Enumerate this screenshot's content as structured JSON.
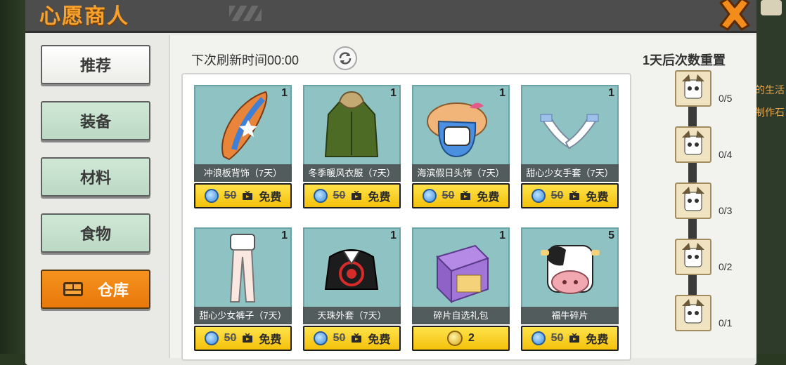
{
  "window": {
    "title": "心愿商人"
  },
  "sidebar": {
    "tabs": [
      {
        "label": "推荐",
        "active": false
      },
      {
        "label": "装备",
        "active": false
      },
      {
        "label": "材料",
        "active": false
      },
      {
        "label": "食物",
        "active": false
      },
      {
        "label": "仓库",
        "active": true
      }
    ]
  },
  "header": {
    "refresh_text": "下次刷新时间00:00",
    "reset_text": "1天后次数重置"
  },
  "items": [
    {
      "name": "冲浪板背饰（7天）",
      "qty": "1",
      "price": "50",
      "free_label": "免费",
      "art": "surfboard"
    },
    {
      "name": "冬季暖风衣服（7天）",
      "qty": "1",
      "price": "50",
      "free_label": "免费",
      "art": "green-coat"
    },
    {
      "name": "海滨假日头饰（7天）",
      "qty": "1",
      "price": "50",
      "free_label": "免费",
      "art": "sunhat"
    },
    {
      "name": "甜心少女手套（7天）",
      "qty": "1",
      "price": "50",
      "free_label": "免费",
      "art": "gloves"
    },
    {
      "name": "甜心少女裤子（7天）",
      "qty": "1",
      "price": "50",
      "free_label": "免费",
      "art": "pants"
    },
    {
      "name": "天珠外套（7天）",
      "qty": "1",
      "price": "50",
      "free_label": "免费",
      "art": "black-jacket"
    },
    {
      "name": "碎片自选礼包",
      "qty": "1",
      "price": "2",
      "free_label": "",
      "art": "gift-box"
    },
    {
      "name": "福牛碎片",
      "qty": "5",
      "price": "50",
      "free_label": "免费",
      "art": "cow"
    }
  ],
  "rewards": [
    {
      "count": "0/5"
    },
    {
      "count": "0/4"
    },
    {
      "count": "0/3"
    },
    {
      "count": "0/2"
    },
    {
      "count": "0/1"
    }
  ],
  "side_text": {
    "line1": "的生活",
    "line2": "制作石"
  },
  "colors": {
    "title": "#f6a12c",
    "active_tab": "#f6921e",
    "buy_button": "#f4c10c",
    "card_bg": "#8fc3c3"
  }
}
